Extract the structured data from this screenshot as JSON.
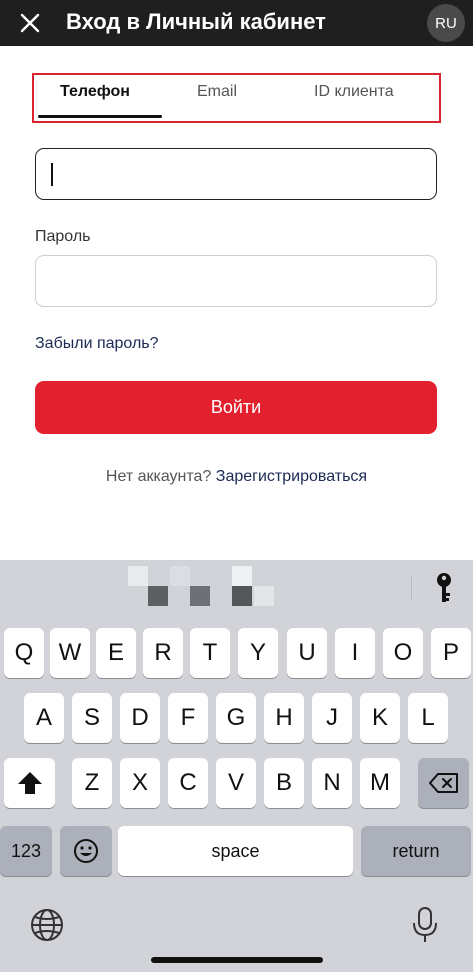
{
  "header": {
    "title": "Вход в Личный кабинет",
    "language": "RU"
  },
  "tabs": [
    {
      "label": "Телефон",
      "active": true
    },
    {
      "label": "Email",
      "active": false
    },
    {
      "label": "ID клиента",
      "active": false
    }
  ],
  "form": {
    "phone_value": "",
    "password_label": "Пароль",
    "password_value": "",
    "forgot_link": "Забыли пароль?",
    "login_button": "Войти",
    "no_account_text": "Нет аккаунта?",
    "register_link": "Зарегистрироваться"
  },
  "keyboard": {
    "row1": [
      "Q",
      "W",
      "E",
      "R",
      "T",
      "Y",
      "U",
      "I",
      "O",
      "P"
    ],
    "row2": [
      "A",
      "S",
      "D",
      "F",
      "G",
      "H",
      "J",
      "K",
      "L"
    ],
    "row3": [
      "Z",
      "X",
      "C",
      "V",
      "B",
      "N",
      "M"
    ],
    "numbers_key": "123",
    "space_key": "space",
    "return_key": "return"
  },
  "colors": {
    "header_bg": "#1f1f1f",
    "accent_red": "#e3202d",
    "link_navy": "#1b2a55"
  }
}
